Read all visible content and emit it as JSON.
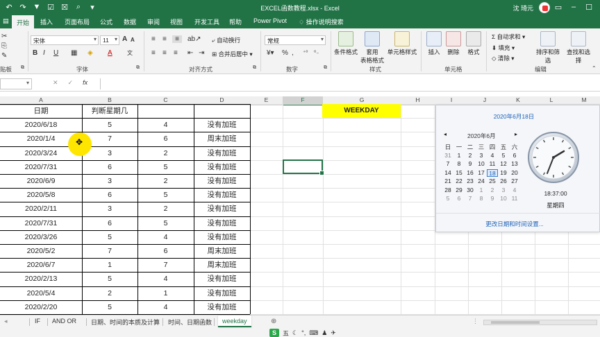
{
  "titlebar": {
    "title": "EXCEL函数教程.xlsx  -  Excel",
    "user": "沈 琦元",
    "qat_icons": [
      "undo-icon",
      "redo-icon",
      "filter-icon",
      "checkbox-icon",
      "check-icon",
      "print-preview-icon",
      "more-icon"
    ]
  },
  "tabs": [
    "开始",
    "插入",
    "页面布局",
    "公式",
    "数据",
    "审阅",
    "视图",
    "开发工具",
    "帮助",
    "Power Pivot"
  ],
  "tell_me": "操作说明搜索",
  "ribbon": {
    "font_name": "宋体",
    "font_size": "11",
    "number_format": "常规",
    "wrap_text": "自动换行",
    "merge_center": "合并后居中",
    "groups": {
      "clipboard": "贴板",
      "font": "字体",
      "alignment": "对齐方式",
      "number": "数字",
      "styles": "样式",
      "cells": "单元格",
      "editing": "编辑"
    },
    "buttons": {
      "conditional_format": "条件格式",
      "table_format_1": "套用",
      "table_format_2": "表格格式",
      "cell_styles": "单元格样式",
      "insert": "插入",
      "delete": "删除",
      "format": "格式",
      "autosum": "自动求和",
      "fill": "填充",
      "clear": "清除",
      "sort_filter": "排序和筛选",
      "find_select": "查找和选择"
    }
  },
  "formula_bar": {
    "cancel": "✕",
    "enter": "✓",
    "fx": "fx"
  },
  "columns": [
    "A",
    "B",
    "C",
    "D",
    "E",
    "F",
    "G",
    "H",
    "I",
    "J",
    "K",
    "L",
    "M"
  ],
  "table": {
    "headers": [
      "日期",
      "判断星期几",
      "",
      ""
    ],
    "rows": [
      [
        "2020/6/18",
        "5",
        "4",
        "没有加班"
      ],
      [
        "2020/1/4",
        "7",
        "6",
        "周末加班"
      ],
      [
        "2020/3/24",
        "3",
        "2",
        "没有加班"
      ],
      [
        "2020/7/31",
        "6",
        "5",
        "没有加班"
      ],
      [
        "2020/6/9",
        "3",
        "2",
        "没有加班"
      ],
      [
        "2020/5/8",
        "6",
        "5",
        "没有加班"
      ],
      [
        "2020/2/11",
        "3",
        "2",
        "没有加班"
      ],
      [
        "2020/7/31",
        "6",
        "5",
        "没有加班"
      ],
      [
        "2020/3/26",
        "5",
        "4",
        "没有加班"
      ],
      [
        "2020/5/2",
        "7",
        "6",
        "周末加班"
      ],
      [
        "2020/6/7",
        "1",
        "7",
        "周末加班"
      ],
      [
        "2020/2/13",
        "5",
        "4",
        "没有加班"
      ],
      [
        "2020/5/4",
        "2",
        "1",
        "没有加班"
      ],
      [
        "2020/2/20",
        "5",
        "4",
        "没有加班"
      ]
    ]
  },
  "weekday_label": "WEEKDAY",
  "calendar": {
    "full_date": "2020年6月18日",
    "month": "2020年6月",
    "weekdays": [
      "日",
      "一",
      "二",
      "三",
      "四",
      "五",
      "六"
    ],
    "days": [
      [
        "31",
        "1",
        "2",
        "3",
        "4",
        "5",
        "6"
      ],
      [
        "7",
        "8",
        "9",
        "10",
        "11",
        "12",
        "13"
      ],
      [
        "14",
        "15",
        "16",
        "17",
        "18",
        "19",
        "20"
      ],
      [
        "21",
        "22",
        "23",
        "24",
        "25",
        "26",
        "27"
      ],
      [
        "28",
        "29",
        "30",
        "1",
        "2",
        "3",
        "4"
      ],
      [
        "5",
        "6",
        "7",
        "8",
        "9",
        "10",
        "11"
      ]
    ],
    "time": "18:37:00",
    "weekday": "星期四",
    "settings_link": "更改日期和时间设置..."
  },
  "sheet_tabs": [
    "IF",
    "AND  OR",
    "日期、时间的本质及计算",
    "时间、日期函数",
    "weekday"
  ],
  "active_sheet": "weekday",
  "statusbar": {
    "ime_label": "五",
    "ime_icons": [
      "moon-icon",
      "comma-icon",
      "keyboard-icon",
      "person-icon",
      "wrench-icon"
    ]
  }
}
